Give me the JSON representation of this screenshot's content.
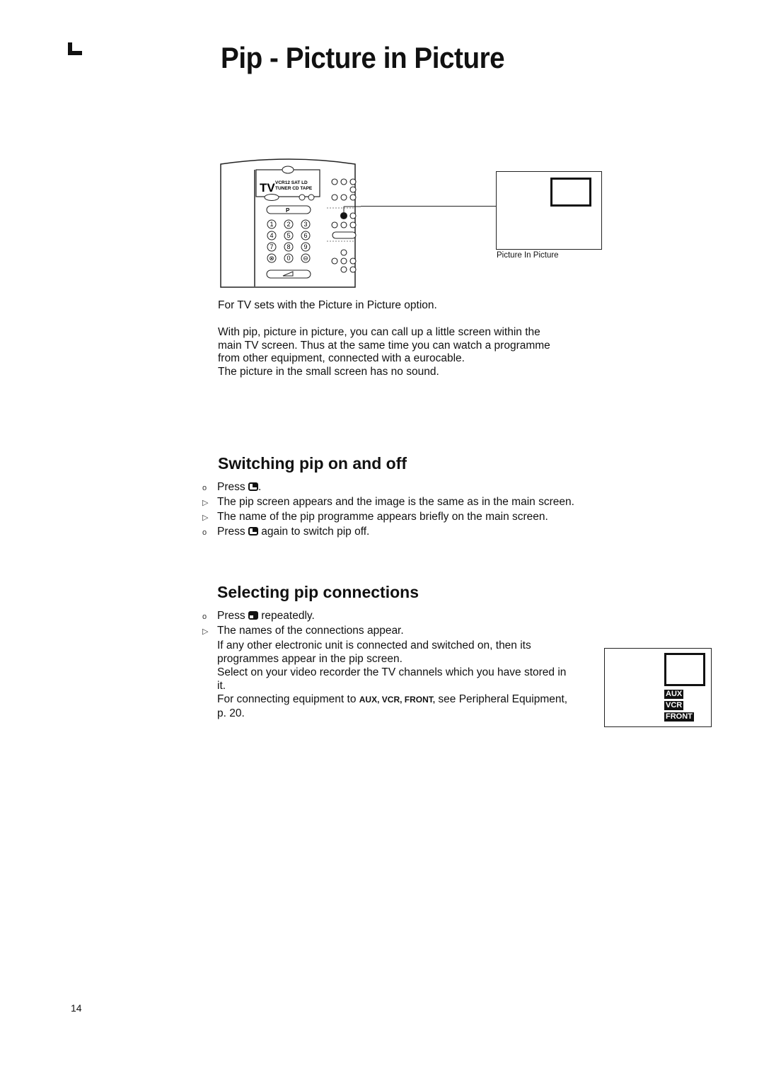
{
  "page": {
    "title": "Pip - Picture in Picture",
    "page_number": "14",
    "corner_mark": "L-shaped registration mark"
  },
  "illustration": {
    "remote": {
      "source_labels_top": "VCR12 SAT  LD",
      "source_labels_bottom": "TUNER CD TAPE",
      "tv_label": "TV",
      "tv_button": "TV",
      "p_button": "P",
      "minus": "-",
      "plus": "+",
      "number_keys": [
        "1",
        "2",
        "3",
        "4",
        "5",
        "6",
        "7",
        "8",
        "9",
        "⊗",
        "0",
        "⊖"
      ]
    },
    "pip_screen_caption": "Picture In Picture"
  },
  "intro": {
    "line1": "For TV sets with the Picture in Picture option.",
    "paragraph": [
      "With pip, picture in picture, you can call up a little screen within the",
      "main TV screen. Thus at the same time you can watch a programme",
      "from other equipment, connected with a eurocable.",
      "The picture in the small screen has no sound."
    ]
  },
  "section_switching": {
    "heading": "Switching pip on and off",
    "items": [
      {
        "marker": "o",
        "text_before": "Press",
        "icon": "pip-button-icon",
        "text_after": "."
      },
      {
        "marker": "▷",
        "text": "The pip screen appears and the image is the same as in the main screen."
      },
      {
        "marker": "▷",
        "text": "The name of the pip programme appears briefly on the main screen."
      },
      {
        "marker": "o",
        "text_before": "Press",
        "icon": "pip-button-icon",
        "text_after": "again to switch pip off."
      }
    ]
  },
  "section_selecting": {
    "heading": "Selecting pip connections",
    "items": [
      {
        "marker": "o",
        "text_before": "Press",
        "icon": "pip-select-button-icon",
        "text_after": "repeatedly."
      },
      {
        "marker": "▷",
        "text": "The names of the connections appear."
      }
    ],
    "paragraph": [
      "If any other electronic unit is connected and switched on, then its programmes appear in the pip screen.",
      "Select on your video recorder the TV channels which you have stored in it."
    ],
    "connect_before": "For connecting equipment to",
    "connect_labels": "AUX, VCR, FRONT,",
    "connect_after": "see Peripheral Equipment, p. 20.",
    "screen_labels": [
      "AUX",
      "VCR",
      "FRONT"
    ]
  }
}
